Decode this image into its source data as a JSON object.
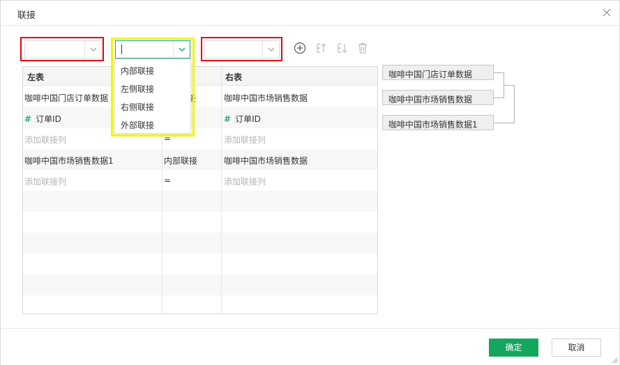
{
  "dialog": {
    "title": "联接",
    "ok_label": "确定",
    "cancel_label": "取消"
  },
  "toolbar": {
    "left_table_value": "",
    "join_type_value": "",
    "right_table_value": "",
    "icons": [
      "add-circle-icon",
      "sort-ascending-icon",
      "sort-descending-icon",
      "trash-icon"
    ]
  },
  "join_type_menu": {
    "options": [
      "内部联接",
      "左侧联接",
      "右侧联接",
      "外部联接"
    ]
  },
  "grid": {
    "headers": {
      "left": "左表",
      "middle": "",
      "right": "右表"
    },
    "rows": [
      {
        "left": "咖啡中国门店订单数据",
        "middle": "接",
        "right": "咖啡中国市场销售数据"
      },
      {
        "left_hash": "#",
        "left": "订单ID",
        "middle": "",
        "right_hash": "#",
        "right": "订单ID"
      },
      {
        "left": "添加联接列",
        "middle": "=",
        "right": "添加联接列"
      },
      {
        "left": "咖啡中国市场销售数据1",
        "middle": "内部联接",
        "right": "咖啡中国市场销售数据"
      },
      {
        "left": "添加联接列",
        "middle": "=",
        "right": "添加联接列"
      }
    ]
  },
  "diagram": {
    "nodes": [
      "咖啡中国门店订单数据",
      "咖啡中国市场销售数据",
      "咖啡中国市场销售数据1"
    ]
  },
  "colors": {
    "primary": "#13a65f",
    "highlight_red": "#e60012",
    "highlight_yellow": "#f5f500",
    "numeric_icon": "#2bb36b"
  }
}
